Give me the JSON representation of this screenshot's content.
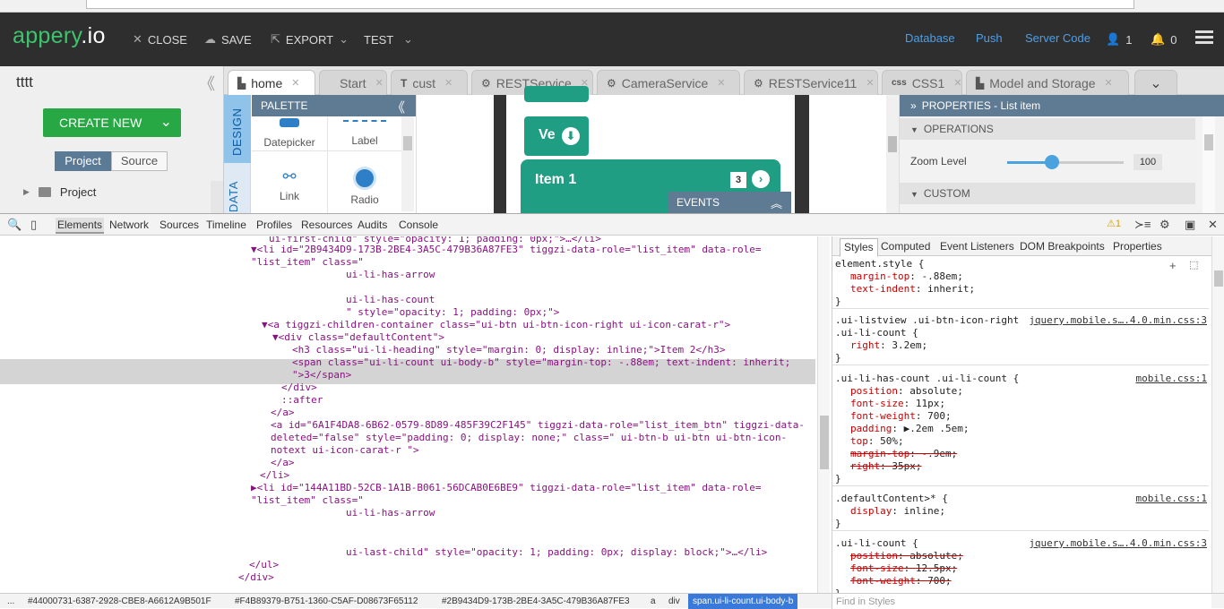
{
  "app": {
    "logo_a": "appery",
    "logo_b": ".io",
    "close": "CLOSE",
    "save": "SAVE",
    "export": "EXPORT",
    "test": "TEST",
    "database": "Database",
    "push": "Push",
    "server_code": "Server Code",
    "user_count": "1",
    "notif_count": "0"
  },
  "project": {
    "name": "tttt",
    "create_new": "CREATE NEW",
    "seg_project": "Project",
    "seg_source": "Source",
    "tree_item": "Project"
  },
  "tabs": [
    {
      "label": "home",
      "icon": "page-icon"
    },
    {
      "label": "Start",
      "icon": ""
    },
    {
      "label": "cust",
      "icon": "T"
    },
    {
      "label": "RESTService",
      "icon": "gear-icon"
    },
    {
      "label": "CameraService",
      "icon": "gear-icon"
    },
    {
      "label": "RESTService11",
      "icon": "gear-icon"
    },
    {
      "label": "CSS1",
      "icon": "css"
    },
    {
      "label": "Model and Storage",
      "icon": "page-icon"
    }
  ],
  "side_tabs": {
    "design": "DESIGN",
    "data": "DATA"
  },
  "palette": {
    "title": "PALETTE",
    "items": [
      "Datepicker",
      "Label",
      "Link",
      "Radio"
    ]
  },
  "canvas": {
    "btn_label": "Ve",
    "item_label": "Item 1",
    "item_count": "3",
    "events": "EVENTS"
  },
  "properties": {
    "title": "PROPERTIES - List item",
    "operations": "OPERATIONS",
    "zoom_label": "Zoom Level",
    "zoom_value": "100",
    "custom": "CUSTOM"
  },
  "devtools": {
    "tabs": [
      "Elements",
      "Network",
      "Sources",
      "Timeline",
      "Profiles",
      "Resources",
      "Audits",
      "Console"
    ],
    "warning_count": "1",
    "styles_tabs": [
      "Styles",
      "Computed",
      "Event Listeners",
      "DOM Breakpoints",
      "Properties"
    ],
    "find_placeholder": "Find in Styles",
    "breadcrumbs": [
      "...",
      "#44000731-6387-2928-CBE8-A6612A9B501F",
      "#F4B89379-B751-1360-C5AF-D08673F65112",
      "#2B9434D9-173B-2BE4-3A5C-479B36A87FE3",
      "a",
      "div",
      "span.ui-li-count.ui-body-b"
    ]
  },
  "dom_lines": [
    {
      "t": "ui-first-child\" style=\"opacity: 1; padding: 0px;\">…</li>"
    },
    {
      "t": "▼<li id=\"2B9434D9-173B-2BE4-3A5C-479B36A87FE3\" tiggzi-data-role=\"list_item\" data-role="
    },
    {
      "t": "\"list_item\" class=\""
    },
    {
      "t": "ui-li-has-arrow"
    },
    {
      "t": ""
    },
    {
      "t": "ui-li-has-count"
    },
    {
      "t": "\" style=\"opacity: 1; padding: 0px;\">"
    },
    {
      "t": "▼<a tiggzi-children-container class=\"ui-btn ui-btn-icon-right ui-icon-carat-r\">"
    },
    {
      "t": "▼<div class=\"defaultContent\">"
    },
    {
      "t": "<h3 class=\"ui-li-heading\" style=\"margin: 0; display: inline;\">Item 2</h3>"
    },
    {
      "t": "<span class=\"ui-li-count ui-body-b\" style=\"margin-top: -.88em; text-indent: inherit;"
    },
    {
      "t": "\">3</span>"
    },
    {
      "t": "</div>"
    },
    {
      "t": "::after"
    },
    {
      "t": "</a>"
    },
    {
      "t": "<a id=\"6A1F4DA8-6B62-0579-8D89-485F39C2F145\" tiggzi-data-role=\"list_item_btn\" tiggzi-data-"
    },
    {
      "t": "deleted=\"false\" style=\"padding: 0; display: none;\" class=\" ui-btn-b ui-btn ui-btn-icon-"
    },
    {
      "t": "notext ui-icon-carat-r \">"
    },
    {
      "t": "</a>"
    },
    {
      "t": "</li>"
    },
    {
      "t": "▶<li id=\"144A11BD-52CB-1A1B-B061-56DCAB0E6BE9\" tiggzi-data-role=\"list_item\" data-role="
    },
    {
      "t": "\"list_item\" class=\""
    },
    {
      "t": "ui-li-has-arrow"
    },
    {
      "t": ""
    },
    {
      "t": ""
    },
    {
      "t": "ui-last-child\" style=\"opacity: 1; padding: 0px; display: block;\">…</li>"
    },
    {
      "t": "</ul>"
    },
    {
      "t": "</div>"
    }
  ],
  "style_rules": [
    {
      "selector": "element.style {",
      "source": "",
      "props": [
        [
          "margin-top",
          "-.88em;",
          false
        ],
        [
          "text-indent",
          "inherit;",
          false
        ]
      ]
    },
    {
      "selector": ".ui-listview .ui-btn-icon-right",
      "selector2": ".ui-li-count {",
      "source": "jquery.mobile.s….4.0.min.css:3",
      "props": [
        [
          "right",
          "3.2em;",
          false
        ]
      ]
    },
    {
      "selector": ".ui-li-has-count .ui-li-count {",
      "source": "mobile.css:1",
      "props": [
        [
          "position",
          "absolute;",
          false
        ],
        [
          "font-size",
          "11px;",
          false
        ],
        [
          "font-weight",
          "700;",
          false
        ],
        [
          "padding",
          "▶.2em .5em;",
          false
        ],
        [
          "top",
          "50%;",
          false
        ],
        [
          "margin-top",
          "-.9em;",
          true
        ],
        [
          "right",
          "35px;",
          true
        ]
      ]
    },
    {
      "selector": ".defaultContent>* {",
      "source": "mobile.css:1",
      "props": [
        [
          "display",
          "inline;",
          false
        ]
      ]
    },
    {
      "selector": ".ui-li-count {",
      "source": "jquery.mobile.s….4.0.min.css:3",
      "props": [
        [
          "position",
          "absolute;",
          true
        ],
        [
          "font-size",
          "12.5px;",
          true
        ],
        [
          "font-weight",
          "700;",
          true
        ]
      ]
    }
  ]
}
